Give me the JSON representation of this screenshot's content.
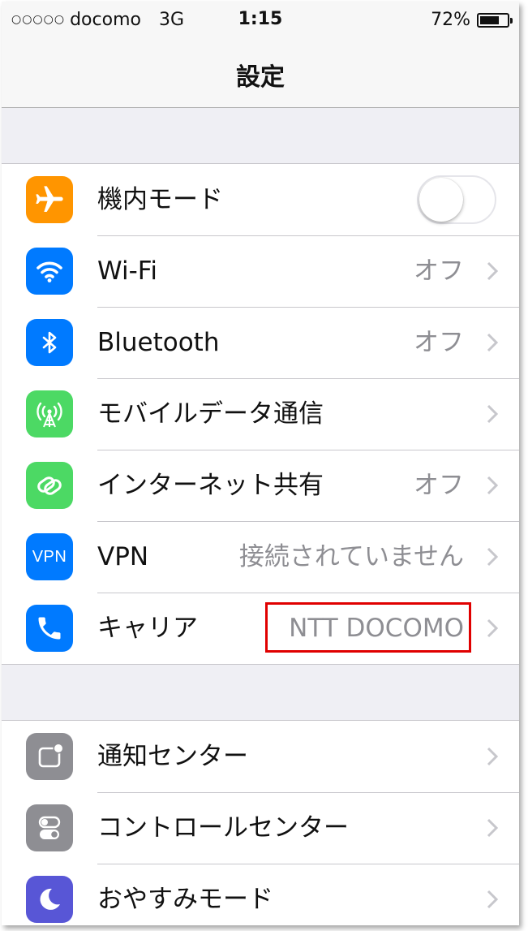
{
  "status_bar": {
    "signal": "○○○○○",
    "carrier": "docomo",
    "network": "3G",
    "time": "1:15",
    "battery_text": "72%",
    "battery_level": 0.72
  },
  "nav": {
    "title": "設定"
  },
  "colors": {
    "orange": "#ff9500",
    "blue": "#007aff",
    "green": "#4cd964",
    "gray": "#8e8e93",
    "purple": "#5856d6",
    "highlight": "#e00000"
  },
  "settings_group_1": [
    {
      "icon": "airplane-icon",
      "label": "機内モード",
      "toggle": false
    },
    {
      "icon": "wifi-icon",
      "label": "Wi-Fi",
      "value": "オフ"
    },
    {
      "icon": "bluetooth-icon",
      "label": "Bluetooth",
      "value": "オフ"
    },
    {
      "icon": "cellular-antenna-icon",
      "label": "モバイルデータ通信",
      "value": ""
    },
    {
      "icon": "link-icon",
      "label": "インターネット共有",
      "value": "オフ"
    },
    {
      "icon": "vpn-icon",
      "icon_text": "VPN",
      "label": "VPN",
      "value": "接続されていません"
    },
    {
      "icon": "phone-icon",
      "label": "キャリア",
      "value": "NTT DOCOMO"
    }
  ],
  "settings_group_2": [
    {
      "icon": "notification-center-icon",
      "label": "通知センター"
    },
    {
      "icon": "control-center-icon",
      "label": "コントロールセンター"
    },
    {
      "icon": "moon-icon",
      "label": "おやすみモード"
    }
  ]
}
